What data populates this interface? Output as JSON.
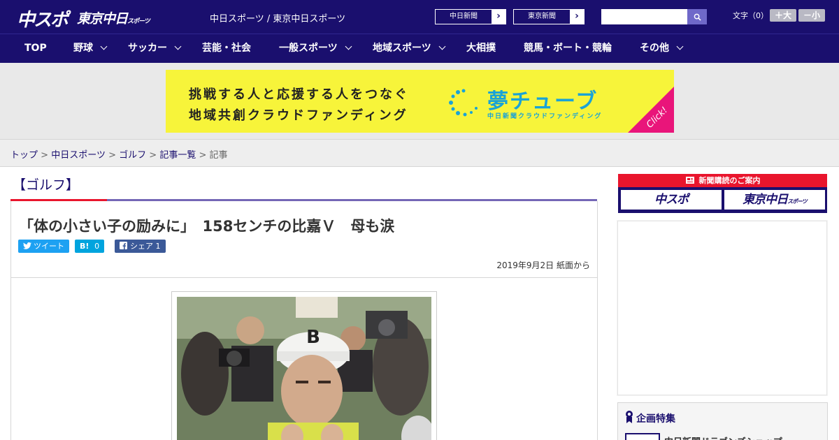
{
  "header": {
    "logo_chuspo": "中スポ",
    "logo_tokyo": "東京中日",
    "logo_tokyo_small": "スポーツ",
    "site_names": "中日スポーツ / 東京中日スポーツ",
    "paper_links": [
      {
        "label": "中日新聞",
        "arrow": "›"
      },
      {
        "label": "東京新聞",
        "arrow": "›"
      }
    ],
    "search_placeholder": "",
    "font_size_label": "文字（0）",
    "font_bigger": "＋大",
    "font_smaller": "－小"
  },
  "nav": {
    "items": [
      {
        "label": "TOP",
        "dropdown": false
      },
      {
        "label": "野球",
        "dropdown": true
      },
      {
        "label": "サッカー",
        "dropdown": true
      },
      {
        "label": "芸能・社会",
        "dropdown": false
      },
      {
        "label": "一般スポーツ",
        "dropdown": true
      },
      {
        "label": "地域スポーツ",
        "dropdown": true
      },
      {
        "label": "大相撲",
        "dropdown": false
      },
      {
        "label": "競馬・ボート・競輪",
        "dropdown": false
      },
      {
        "label": "その他",
        "dropdown": true
      }
    ]
  },
  "banner_ad": {
    "line1": "挑戦する人と応援する人をつなぐ",
    "line2": "地域共創クラウドファンディング",
    "brand": "夢チューブ",
    "brand_sub": "中日新聞クラウドファンディング",
    "cta": "Click!"
  },
  "breadcrumb": {
    "items": [
      "トップ",
      "中日スポーツ",
      "ゴルフ",
      "記事一覧"
    ],
    "separator": ">",
    "current": "記事"
  },
  "article": {
    "category": "【ゴルフ】",
    "headline": "「体の小さい子の励みに」　158センチの比嘉Ｖ　母も涙",
    "share": {
      "tweet_label": "ツイート",
      "hatena_label": "B!",
      "hatena_count": "0",
      "facebook_label": "シェア",
      "facebook_count": "1"
    },
    "date": "2019年9月2日 紙面から"
  },
  "sidebar": {
    "subscribe_header": "新聞購読のご案内",
    "subscribe_chuspo": "中スポ",
    "subscribe_tokyo": "東京中日",
    "subscribe_tokyo_small": "スポーツ",
    "feature_title": "企画特集",
    "feature_item": "中日新聞ドラゴンズショップ"
  },
  "colors": {
    "brand_navy": "#1a0f6e",
    "accent_red": "#e9152d",
    "ad_yellow": "#f7f43a",
    "ad_blue": "#1aa3d6",
    "twitter": "#1da1f2",
    "hatena": "#00a4de",
    "facebook": "#3b5998"
  }
}
